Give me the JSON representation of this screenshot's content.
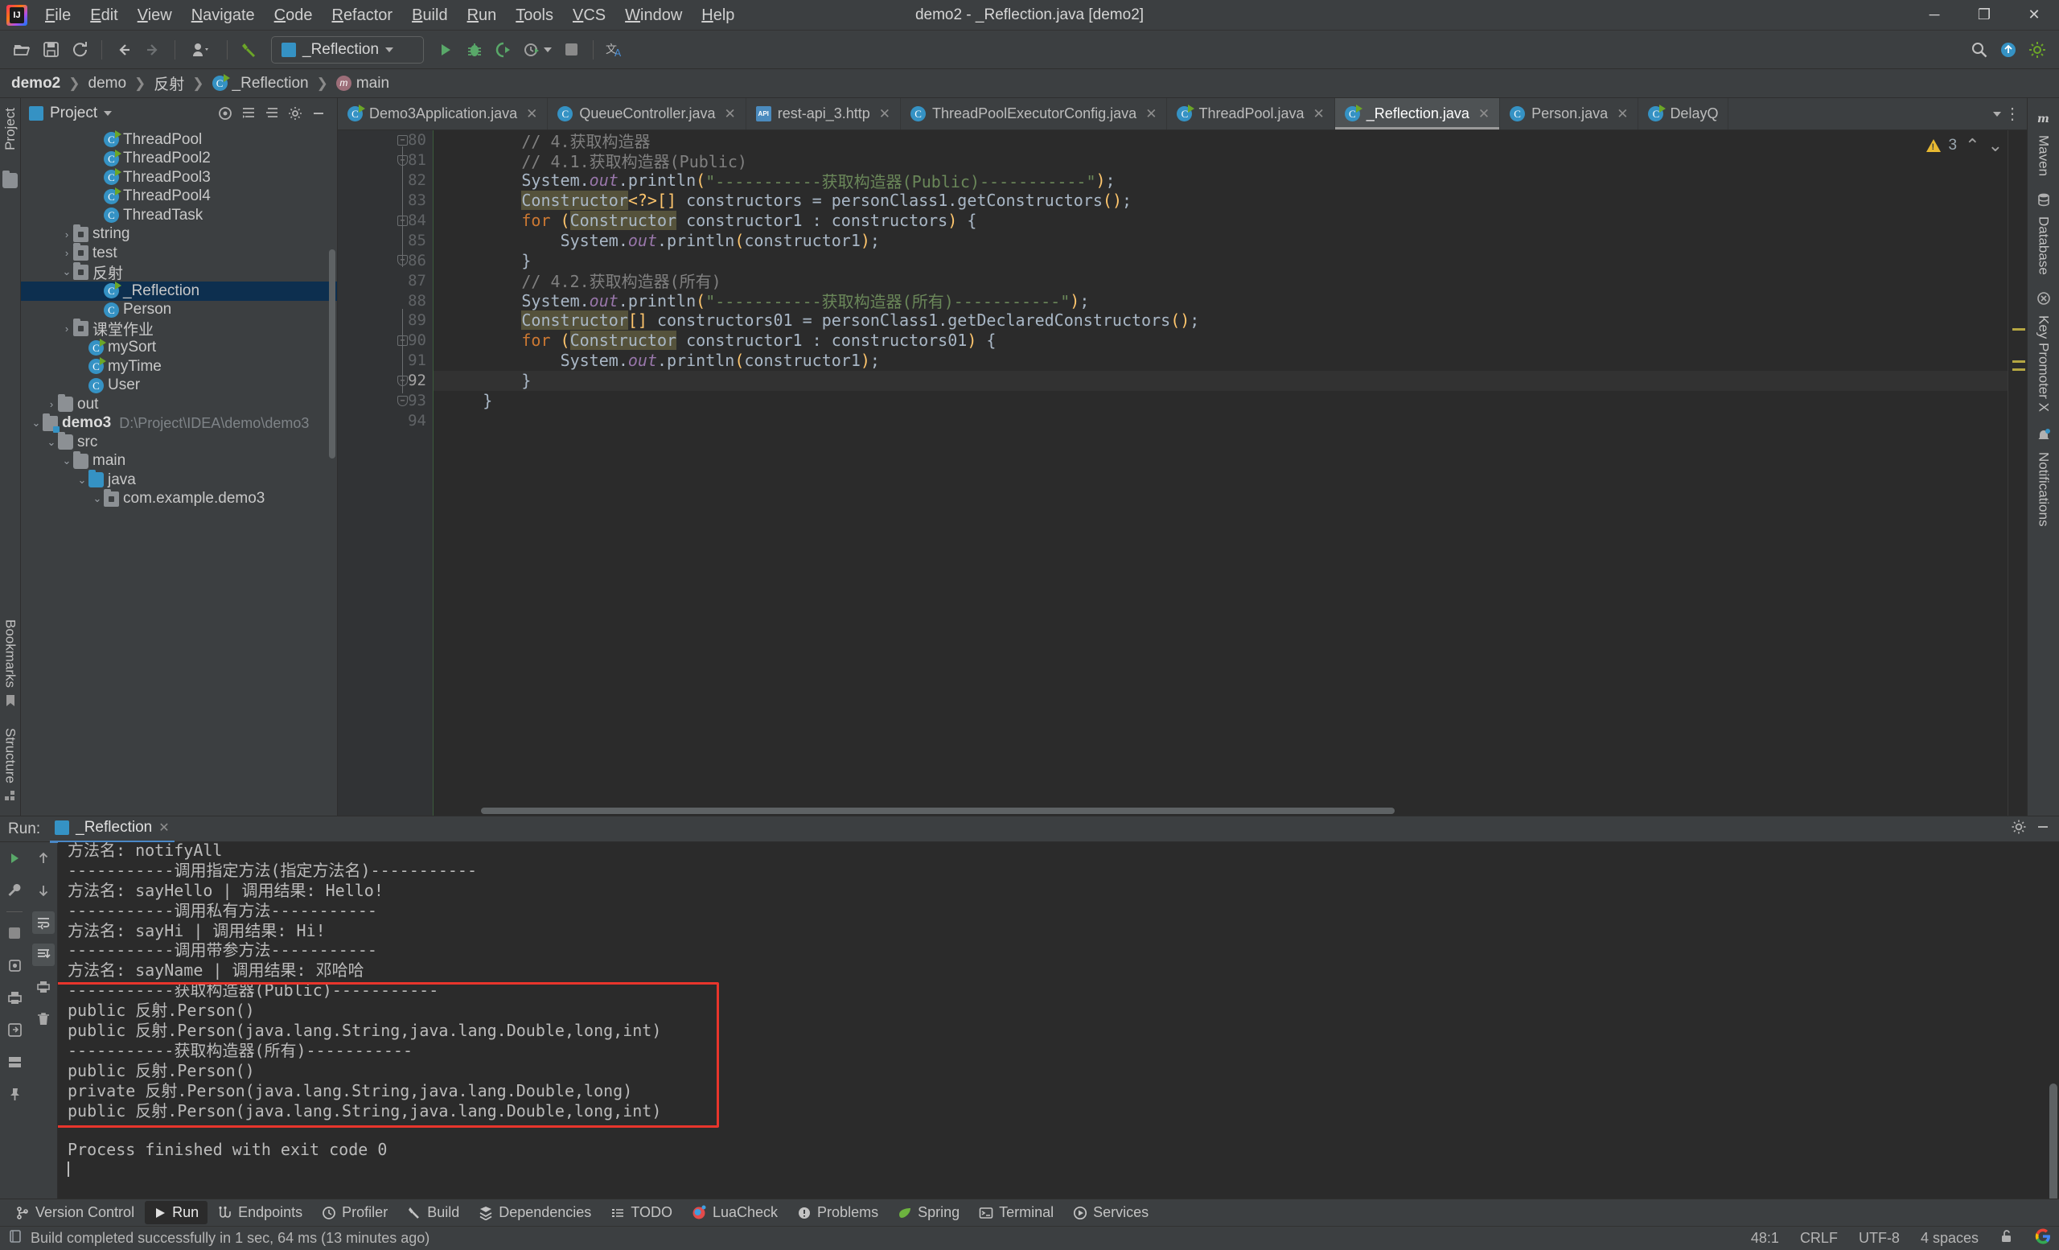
{
  "window": {
    "title": "demo2 - _Reflection.java [demo2]",
    "logo": "intellij-idea-logo",
    "controls": {
      "minimize": "─",
      "maximize": "❐",
      "close": "✕"
    }
  },
  "menu": [
    {
      "label": "File"
    },
    {
      "label": "Edit"
    },
    {
      "label": "View"
    },
    {
      "label": "Navigate"
    },
    {
      "label": "Code"
    },
    {
      "label": "Refactor"
    },
    {
      "label": "Build"
    },
    {
      "label": "Run"
    },
    {
      "label": "Tools"
    },
    {
      "label": "VCS"
    },
    {
      "label": "Window"
    },
    {
      "label": "Help"
    }
  ],
  "toolbar": {
    "open_icon": "open-folder-icon",
    "save_icon": "save-icon",
    "sync_icon": "refresh-icon",
    "back_icon": "arrow-left-icon",
    "forward_icon": "arrow-right-icon",
    "profile_icon": "user-profile-icon",
    "build_icon": "hammer-icon",
    "run_config_name": "_Reflection",
    "run_icon": "run-green-triangle-icon",
    "debug_icon": "debug-bug-icon",
    "run_coverage_icon": "run-with-coverage-icon",
    "profiler_icon": "profiler-clock-icon",
    "stop_icon": "stop-square-icon",
    "translate_icon": "translate-icon",
    "search_icon": "search-magnifier-icon",
    "updates_icon": "update-arrow-icon",
    "settings_icon": "gear-icon"
  },
  "breadcrumb": [
    {
      "label": "demo2",
      "bold": true,
      "icon": ""
    },
    {
      "label": "demo",
      "bold": false,
      "icon": ""
    },
    {
      "label": "反射",
      "bold": false,
      "icon": ""
    },
    {
      "label": "_Reflection",
      "bold": false,
      "icon": "class-icon"
    },
    {
      "label": "main",
      "bold": false,
      "icon": "method-icon"
    }
  ],
  "left_stripe": {
    "project_label": "Project",
    "bookmarks_label": "Bookmarks",
    "structure_label": "Structure"
  },
  "right_stripe": [
    {
      "label": "Maven",
      "icon": "maven-m-icon"
    },
    {
      "label": "Database",
      "icon": "database-icon"
    },
    {
      "label": "Key Promoter X",
      "icon": "key-promoter-icon"
    },
    {
      "label": "Notifications",
      "icon": "bell-icon"
    }
  ],
  "project_panel": {
    "title": "Project",
    "dropdown_icon": "chevron-down-icon",
    "icons": [
      "target-icon",
      "expand-all-icon",
      "collapse-all-icon",
      "gear-icon",
      "minimize-icon"
    ],
    "tree": [
      {
        "label": "ThreadPool",
        "indent": 5,
        "icon": "class-run-icon",
        "arrow": "",
        "selected": false
      },
      {
        "label": "ThreadPool2",
        "indent": 5,
        "icon": "class-run-icon",
        "arrow": "",
        "selected": false
      },
      {
        "label": "ThreadPool3",
        "indent": 5,
        "icon": "class-run-icon",
        "arrow": "",
        "selected": false
      },
      {
        "label": "ThreadPool4",
        "indent": 5,
        "icon": "class-run-icon",
        "arrow": "",
        "selected": false
      },
      {
        "label": "ThreadTask",
        "indent": 5,
        "icon": "class-icon",
        "arrow": "",
        "selected": false
      },
      {
        "label": "string",
        "indent": 3,
        "icon": "package-icon",
        "arrow": "›",
        "selected": false
      },
      {
        "label": "test",
        "indent": 3,
        "icon": "package-icon",
        "arrow": "›",
        "selected": false
      },
      {
        "label": "反射",
        "indent": 3,
        "icon": "package-icon",
        "arrow": "⌄",
        "selected": false
      },
      {
        "label": "_Reflection",
        "indent": 5,
        "icon": "class-run-icon",
        "arrow": "",
        "selected": true
      },
      {
        "label": "Person",
        "indent": 5,
        "icon": "class-icon",
        "arrow": "",
        "selected": false
      },
      {
        "label": "课堂作业",
        "indent": 3,
        "icon": "package-icon",
        "arrow": "›",
        "selected": false
      },
      {
        "label": "mySort",
        "indent": 4,
        "icon": "class-run-icon",
        "arrow": "",
        "selected": false
      },
      {
        "label": "myTime",
        "indent": 4,
        "icon": "class-run-icon",
        "arrow": "",
        "selected": false
      },
      {
        "label": "User",
        "indent": 4,
        "icon": "class-icon",
        "arrow": "",
        "selected": false
      },
      {
        "label": "out",
        "indent": 2,
        "icon": "folder-icon",
        "arrow": "›",
        "selected": false
      },
      {
        "label": "demo3",
        "indent": 1,
        "icon": "module-icon",
        "arrow": "⌄",
        "selected": false,
        "bold": true,
        "path": "D:\\Project\\IDEA\\demo\\demo3"
      },
      {
        "label": "src",
        "indent": 2,
        "icon": "folder-icon",
        "arrow": "⌄",
        "selected": false
      },
      {
        "label": "main",
        "indent": 3,
        "icon": "folder-icon",
        "arrow": "⌄",
        "selected": false
      },
      {
        "label": "java",
        "indent": 4,
        "icon": "folder-blue-icon",
        "arrow": "⌄",
        "selected": false
      },
      {
        "label": "com.example.demo3",
        "indent": 5,
        "icon": "package-icon",
        "arrow": "⌄",
        "selected": false
      }
    ]
  },
  "editor": {
    "tabs": [
      {
        "label": "Demo3Application.java",
        "icon": "class-run-icon",
        "active": false
      },
      {
        "label": "QueueController.java",
        "icon": "class-icon",
        "active": false
      },
      {
        "label": "rest-api_3.http",
        "icon": "http-api-icon",
        "active": false
      },
      {
        "label": "ThreadPoolExecutorConfig.java",
        "icon": "class-icon",
        "active": false
      },
      {
        "label": "ThreadPool.java",
        "icon": "class-run-icon",
        "active": false
      },
      {
        "label": "_Reflection.java",
        "icon": "class-run-icon",
        "active": true
      },
      {
        "label": "Person.java",
        "icon": "class-icon",
        "active": false
      },
      {
        "label": "DelayQ",
        "icon": "class-run-icon",
        "active": false
      }
    ],
    "tab_close_glyph": "✕",
    "inspection": {
      "warning_icon": "warning-triangle-icon",
      "count": "3",
      "up": "⌃",
      "down": "⌄"
    },
    "first_line_number": 80,
    "current_line": 92,
    "lines": [
      {
        "n": 80,
        "fold": "minus",
        "text": "        // 4.获取构造器"
      },
      {
        "n": 81,
        "fold": "end",
        "text": "        // 4.1.获取构造器(Public)"
      },
      {
        "n": 82,
        "fold": "",
        "text": "        System.out.println(\"-----------获取构造器(Public)-----------\");"
      },
      {
        "n": 83,
        "fold": "",
        "text": "        Constructor<?>[] constructors = personClass1.getConstructors();"
      },
      {
        "n": 84,
        "fold": "minus",
        "text": "        for (Constructor constructor1 : constructors) {"
      },
      {
        "n": 85,
        "fold": "",
        "text": "            System.out.println(constructor1);"
      },
      {
        "n": 86,
        "fold": "end",
        "text": "        }"
      },
      {
        "n": 87,
        "fold": "",
        "text": "        // 4.2.获取构造器(所有)"
      },
      {
        "n": 88,
        "fold": "",
        "text": "        System.out.println(\"-----------获取构造器(所有)-----------\");"
      },
      {
        "n": 89,
        "fold": "",
        "text": "        Constructor[] constructors01 = personClass1.getDeclaredConstructors();"
      },
      {
        "n": 90,
        "fold": "minus",
        "text": "        for (Constructor constructor1 : constructors01) {"
      },
      {
        "n": 91,
        "fold": "",
        "text": "            System.out.println(constructor1);"
      },
      {
        "n": 92,
        "fold": "end",
        "text": "        }"
      },
      {
        "n": 93,
        "fold": "end",
        "text": "    }"
      },
      {
        "n": 94,
        "fold": "",
        "text": ""
      }
    ]
  },
  "run_panel": {
    "label": "Run:",
    "tab_name": "_Reflection",
    "tab_icon": "run-config-icon",
    "tab_close": "✕",
    "settings_icon": "gear-icon",
    "minimize_icon": "minimize-icon",
    "side_buttons_left": [
      "rerun-icon",
      "wrench-icon",
      "stop-icon",
      "dump-threads-icon",
      "print-icon",
      "restore-layout-icon",
      "grid-icon",
      "pin-icon"
    ],
    "side_buttons_right": [
      "scroll-up-icon",
      "scroll-down-icon",
      "soft-wrap-icon",
      "scroll-to-end-icon",
      "print-icon",
      "trash-icon"
    ],
    "console_lines": [
      {
        "text": "方法名: notifyAll",
        "clipped": true
      },
      {
        "text": "-----------调用指定方法(指定方法名)-----------"
      },
      {
        "text": "方法名: sayHello | 调用结果: Hello!"
      },
      {
        "text": "-----------调用私有方法-----------"
      },
      {
        "text": "方法名: sayHi | 调用结果: Hi!"
      },
      {
        "text": "-----------调用带参方法-----------"
      },
      {
        "text": "方法名: sayName | 调用结果: 邓哈哈"
      },
      {
        "text": "-----------获取构造器(Public)-----------",
        "boxed": true
      },
      {
        "text": "public 反射.Person()",
        "boxed": true
      },
      {
        "text": "public 反射.Person(java.lang.String,java.lang.Double,long,int)",
        "boxed": true
      },
      {
        "text": "-----------获取构造器(所有)-----------",
        "boxed": true
      },
      {
        "text": "public 反射.Person()",
        "boxed": true
      },
      {
        "text": "private 反射.Person(java.lang.String,java.lang.Double,long)",
        "boxed": true
      },
      {
        "text": "public 反射.Person(java.lang.String,java.lang.Double,long,int)",
        "boxed": true
      },
      {
        "text": ""
      },
      {
        "text": "Process finished with exit code 0"
      }
    ],
    "highlight_color": "#e8352c"
  },
  "bottom_bar": [
    {
      "label": "Version Control",
      "icon": "branch-icon",
      "active": false
    },
    {
      "label": "Run",
      "icon": "run-triangle-icon",
      "active": true
    },
    {
      "label": "Endpoints",
      "icon": "endpoints-icon",
      "active": false
    },
    {
      "label": "Profiler",
      "icon": "profiler-icon",
      "active": false
    },
    {
      "label": "Build",
      "icon": "hammer-icon",
      "active": false
    },
    {
      "label": "Dependencies",
      "icon": "dependencies-icon",
      "active": false
    },
    {
      "label": "TODO",
      "icon": "todo-list-icon",
      "active": false
    },
    {
      "label": "LuaCheck",
      "icon": "luacheck-icon",
      "active": false
    },
    {
      "label": "Problems",
      "icon": "problems-icon",
      "active": false
    },
    {
      "label": "Spring",
      "icon": "spring-leaf-icon",
      "active": false
    },
    {
      "label": "Terminal",
      "icon": "terminal-icon",
      "active": false
    },
    {
      "label": "Services",
      "icon": "services-icon",
      "active": false
    }
  ],
  "status_bar": {
    "build_icon": "build-status-icon",
    "message": "Build completed successfully in 1 sec, 64 ms (13 minutes ago)",
    "caret_position": "48:1",
    "line_separator": "CRLF",
    "encoding": "UTF-8",
    "indent": "4 spaces",
    "lock_icon": "unlocked-padlock-icon",
    "google_icon": "google-g-icon"
  },
  "colors": {
    "accent_blue": "#3592c4",
    "run_green": "#59a869",
    "warning_yellow": "#e8b931",
    "error_red": "#e8352c",
    "selection_navy": "#0d2f4f",
    "bg_panel": "#3c3f41",
    "bg_editor": "#2b2b2b"
  }
}
